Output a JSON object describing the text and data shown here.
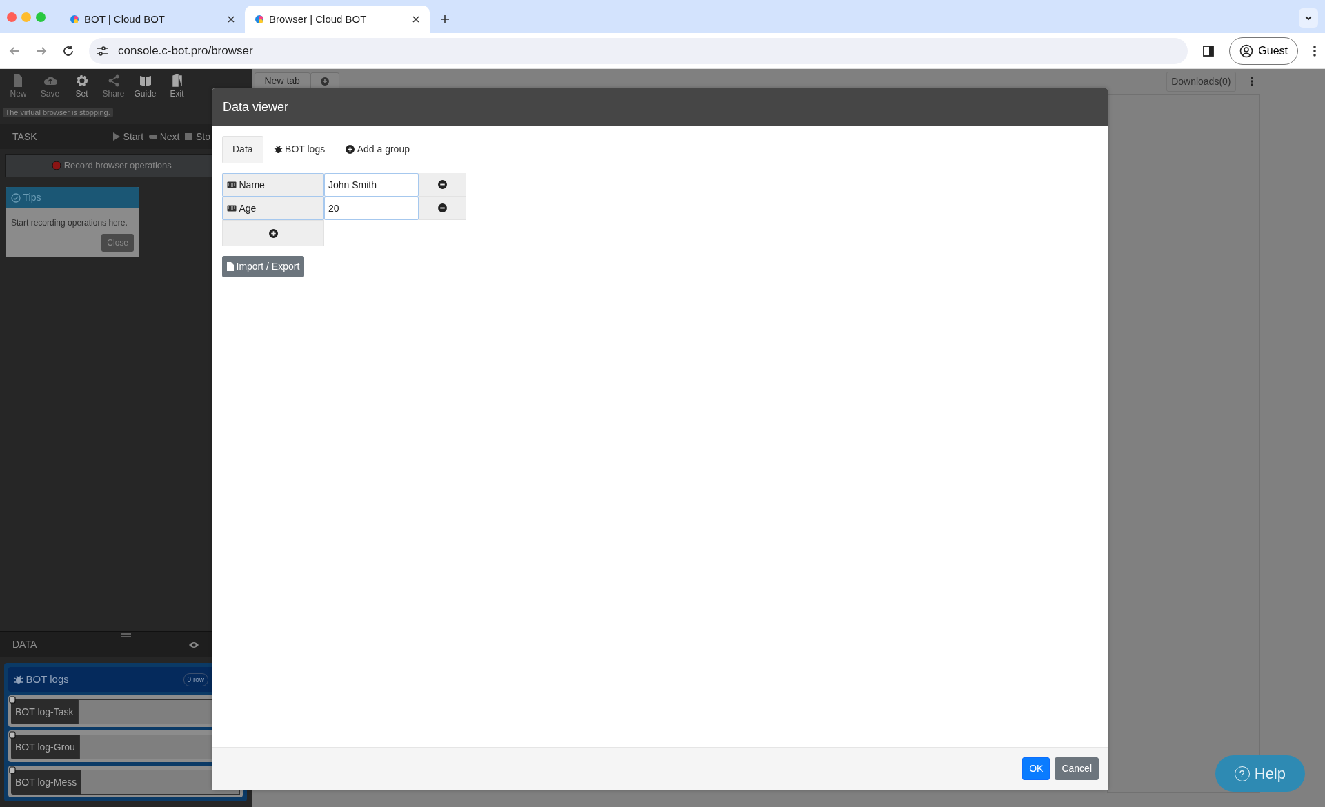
{
  "browser": {
    "tabs": [
      {
        "title": "BOT | Cloud BOT",
        "selected": false
      },
      {
        "title": "Browser | Cloud BOT",
        "selected": true
      }
    ],
    "url": "console.c-bot.pro/browser",
    "profile": "Guest"
  },
  "toolbar": [
    {
      "label": "New",
      "disabled": true
    },
    {
      "label": "Save",
      "disabled": true
    },
    {
      "label": "Set",
      "disabled": false
    },
    {
      "label": "Share",
      "disabled": true
    },
    {
      "label": "Guide",
      "disabled": false
    },
    {
      "label": "Exit",
      "disabled": false
    }
  ],
  "status_message": "The virtual browser is stopping.",
  "task": {
    "title": "TASK",
    "actions": [
      "Start",
      "Next",
      "Sto"
    ],
    "record_button": "Record browser operations"
  },
  "tips": {
    "title": "Tips",
    "text": "Start recording operations here.",
    "close": "Close"
  },
  "data_panel": {
    "title": "DATA",
    "group": {
      "title": "BOT logs",
      "count": "0 row"
    },
    "fields": [
      "BOT log-Task",
      "BOT log-Grou",
      "BOT log-Mess"
    ]
  },
  "page_tabs": [
    {
      "label": "New tab"
    }
  ],
  "downloads": "Downloads(0)",
  "dialog": {
    "title": "Data viewer",
    "tabs": [
      {
        "label": "Data",
        "kind": "plain",
        "selected": true
      },
      {
        "label": "BOT logs",
        "kind": "bug",
        "selected": false
      },
      {
        "label": "Add a group",
        "kind": "add",
        "selected": false
      }
    ],
    "rows": [
      {
        "name": "Name",
        "value": "John Smith"
      },
      {
        "name": "Age",
        "value": "20"
      }
    ],
    "import_export": "Import / Export",
    "buttons": [
      {
        "label": "OK",
        "kind": "primary"
      },
      {
        "label": "Cancel",
        "kind": "secondary"
      }
    ]
  },
  "help": "Help",
  "help_icon": "?"
}
